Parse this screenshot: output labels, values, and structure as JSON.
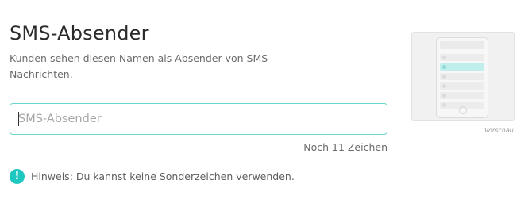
{
  "header": {
    "title": "SMS-Absender",
    "description": "Kunden sehen diesen Namen als Absender von SMS-Nachrichten."
  },
  "sender_field": {
    "value": "",
    "placeholder": "SMS-Absender",
    "remaining": "Noch 11 Zeichen"
  },
  "hint": {
    "icon": "exclamation-icon",
    "text": "Hinweis: Du kannst keine Sonderzeichen verwenden."
  },
  "preview": {
    "label": "Vorschau"
  },
  "colors": {
    "accent": "#1fc7c1",
    "focus_border": "#6fd6cf"
  }
}
